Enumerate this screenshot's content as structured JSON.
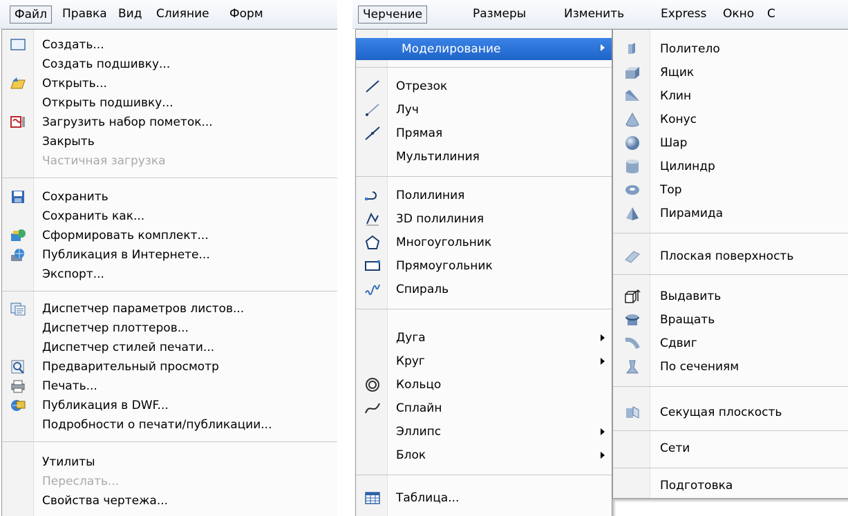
{
  "left": {
    "menubar": [
      "Файл",
      "Правка",
      "Вид",
      "Слияние",
      "Форм"
    ],
    "items": [
      {
        "label": "Создать...",
        "icon": "new-document-icon"
      },
      {
        "label": "Создать подшивку..."
      },
      {
        "label": "Открыть...",
        "icon": "open-folder-icon"
      },
      {
        "label": "Открыть подшивку..."
      },
      {
        "label": "Загрузить набор пометок...",
        "icon": "markup-set-icon"
      },
      {
        "label": "Закрыть"
      },
      {
        "label": "Частичная загрузка",
        "disabled": true
      },
      {
        "label": "Сохранить",
        "icon": "save-icon"
      },
      {
        "label": "Сохранить как..."
      },
      {
        "label": "Сформировать комплект...",
        "icon": "etransmit-icon"
      },
      {
        "label": "Публикация в Интернете...",
        "icon": "publish-web-icon"
      },
      {
        "label": "Экспорт..."
      },
      {
        "label": "Диспетчер параметров листов...",
        "icon": "page-setup-icon"
      },
      {
        "label": "Диспетчер плоттеров..."
      },
      {
        "label": "Диспетчер стилей печати..."
      },
      {
        "label": "Предварительный просмотр",
        "icon": "preview-icon"
      },
      {
        "label": "Печать...",
        "icon": "print-icon"
      },
      {
        "label": "Публикация в DWF...",
        "icon": "publish-dwf-icon"
      },
      {
        "label": "Подробности о печати/публикации..."
      },
      {
        "label": "Утилиты"
      },
      {
        "label": "Переслать...",
        "disabled": true
      },
      {
        "label": "Свойства чертежа..."
      }
    ]
  },
  "right": {
    "menubar": [
      "Черчение",
      "Размеры",
      "Изменить",
      "Express",
      "Окно",
      "С"
    ],
    "draw_items": [
      {
        "label": "Моделирование",
        "submenu": true,
        "highlighted": true
      },
      {
        "label": "Отрезок",
        "icon": "line-icon"
      },
      {
        "label": "Луч",
        "icon": "ray-icon"
      },
      {
        "label": "Прямая",
        "icon": "xline-icon"
      },
      {
        "label": "Мультилиния"
      },
      {
        "label": "Полилиния",
        "icon": "polyline-icon"
      },
      {
        "label": "3D полилиния",
        "icon": "3d-polyline-icon"
      },
      {
        "label": "Многоугольник",
        "icon": "polygon-icon"
      },
      {
        "label": "Прямоугольник",
        "icon": "rectangle-icon"
      },
      {
        "label": "Спираль",
        "icon": "helix-icon"
      },
      {
        "label": "Дуга",
        "submenu": true
      },
      {
        "label": "Круг",
        "submenu": true
      },
      {
        "label": "Кольцо",
        "icon": "donut-icon"
      },
      {
        "label": "Сплайн",
        "icon": "spline-icon"
      },
      {
        "label": "Эллипс",
        "submenu": true
      },
      {
        "label": "Блок",
        "submenu": true
      },
      {
        "label": "Таблица...",
        "icon": "table-icon"
      }
    ],
    "modeling_items": [
      {
        "label": "Политело",
        "icon": "polysolid-icon"
      },
      {
        "label": "Ящик",
        "icon": "box-icon"
      },
      {
        "label": "Клин",
        "icon": "wedge-icon"
      },
      {
        "label": "Конус",
        "icon": "cone-icon"
      },
      {
        "label": "Шар",
        "icon": "sphere-icon"
      },
      {
        "label": "Цилиндр",
        "icon": "cylinder-icon"
      },
      {
        "label": "Тор",
        "icon": "torus-icon"
      },
      {
        "label": "Пирамида",
        "icon": "pyramid-icon"
      },
      {
        "label": "Плоская поверхность",
        "icon": "planar-surface-icon"
      },
      {
        "label": "Выдавить",
        "icon": "extrude-icon"
      },
      {
        "label": "Вращать",
        "icon": "revolve-icon"
      },
      {
        "label": "Сдвиг",
        "icon": "sweep-icon"
      },
      {
        "label": "По сечениям",
        "icon": "loft-icon"
      },
      {
        "label": "Секущая плоскость",
        "icon": "section-plane-icon"
      },
      {
        "label": "Сети"
      },
      {
        "label": "Подготовка"
      }
    ]
  },
  "colors": {
    "highlight": "#2a72d8",
    "disabled_text": "#a9a9a9"
  }
}
